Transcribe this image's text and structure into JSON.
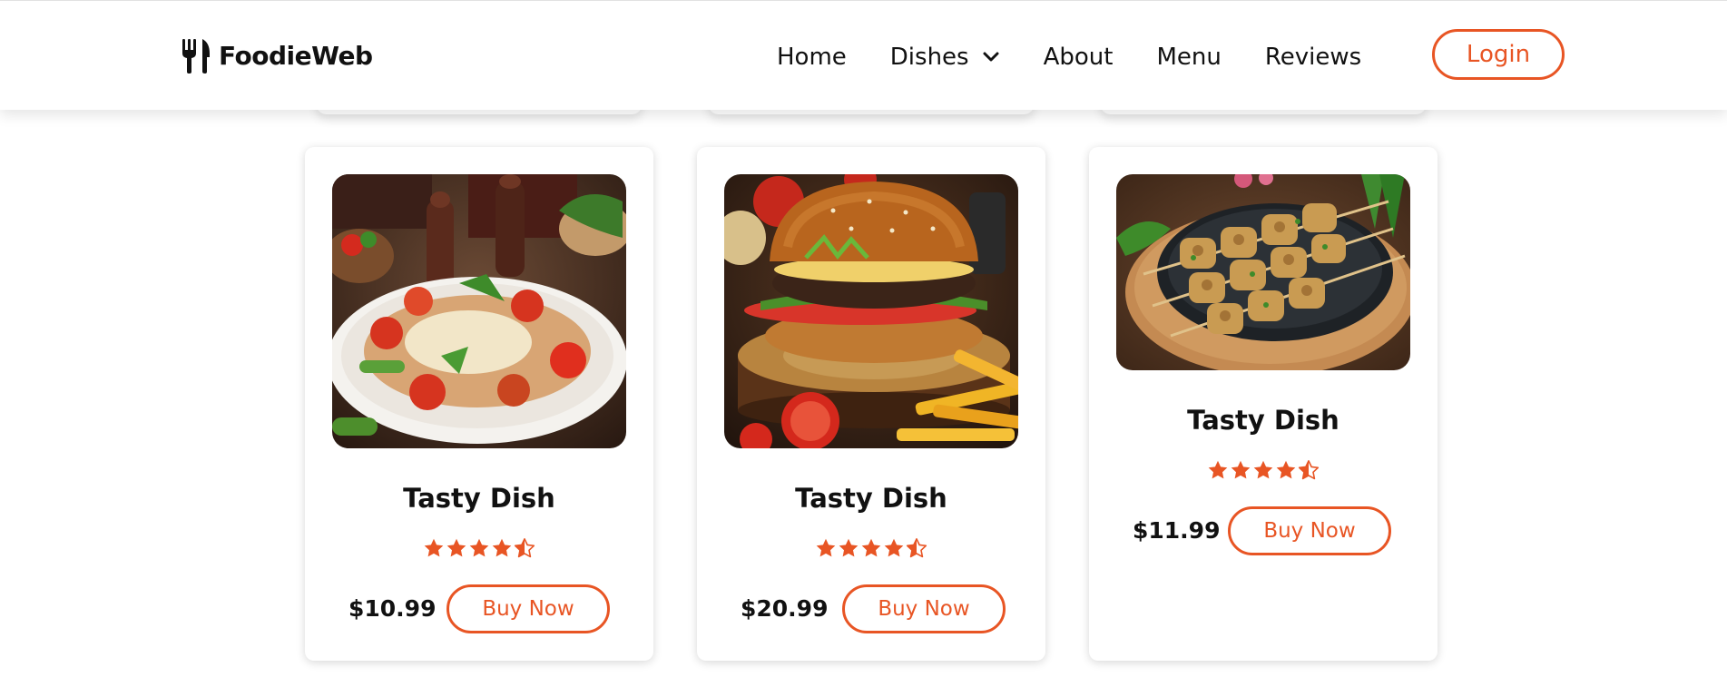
{
  "brand": {
    "name": "FoodieWeb",
    "icon": "fork-knife-icon",
    "accent_color": "#e85524"
  },
  "nav": {
    "items": [
      {
        "label": "Home"
      },
      {
        "label": "Dishes",
        "icon": "chevron-down-icon"
      },
      {
        "label": "About"
      },
      {
        "label": "Menu"
      },
      {
        "label": "Reviews"
      }
    ],
    "login_label": "Login"
  },
  "dishes": [
    {
      "title": "Tasty Dish",
      "rating": 4.5,
      "max_rating": 5,
      "price": "$10.99",
      "button_label": "Buy Now",
      "image": "kebab-platter-photo"
    },
    {
      "title": "Tasty Dish",
      "rating": 4.5,
      "max_rating": 5,
      "price": "$20.99",
      "button_label": "Buy Now",
      "image": "burger-and-fries-photo"
    },
    {
      "title": "Tasty Dish",
      "rating": 4.5,
      "max_rating": 5,
      "price": "$11.99",
      "button_label": "Buy Now",
      "image": "chicken-skewers-photo"
    }
  ]
}
